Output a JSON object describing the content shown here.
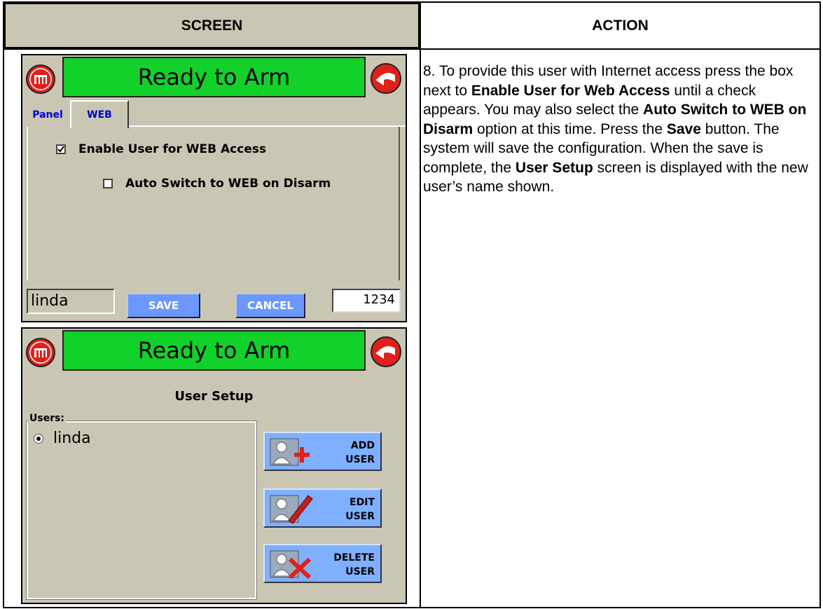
{
  "table": {
    "screen_header": "SCREEN",
    "action_header": "ACTION"
  },
  "action": {
    "p1": "8.  To provide this user with Internet access press the box next to ",
    "b1": "Enable User for Web Access",
    "p2": " until a check appears.  You may also select the ",
    "b2": "Auto Switch to WEB on Disarm",
    "p3": " option at this time.  Press the ",
    "b3": "Save",
    "p4": " button.  The system will save the configuration.  When the save is complete, the ",
    "b4": "User Setup",
    "p5": " screen is displayed with the new user’s name shown."
  },
  "screen1": {
    "title": "Ready to Arm",
    "tabs": [
      {
        "label": "Panel"
      },
      {
        "label": "WEB"
      }
    ],
    "options": [
      {
        "label": "Enable User for WEB Access",
        "checked": true
      },
      {
        "label": "Auto Switch to WEB on Disarm",
        "checked": false
      }
    ],
    "user_name": "linda",
    "save_label": "SAVE",
    "cancel_label": "CANCEL",
    "code": "1234"
  },
  "screen2": {
    "title": "Ready to Arm",
    "subtitle": "User Setup",
    "users_label": "Users:",
    "users": [
      {
        "name": "linda",
        "selected": true
      }
    ],
    "buttons": {
      "add": {
        "line1": "ADD",
        "line2": "USER"
      },
      "edit": {
        "line1": "EDIT",
        "line2": "USER"
      },
      "delete": {
        "line1": "DELETE",
        "line2": "USER"
      }
    }
  },
  "colors": {
    "panel_bg": "#c9c6b3",
    "title_green": "#12d12a",
    "button_blue": "#6b97ff",
    "icon_red": "#e0201a"
  },
  "icons": [
    "home-icon",
    "back-arrow-icon",
    "add-user-icon",
    "edit-user-icon",
    "delete-user-icon"
  ]
}
